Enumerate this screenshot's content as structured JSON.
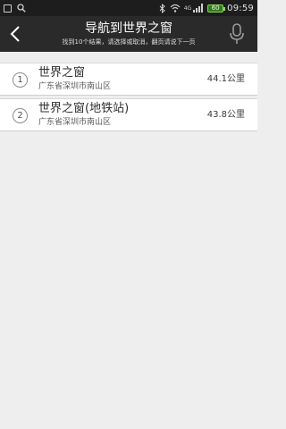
{
  "status_bar": {
    "icons_left": [
      "notification-box-icon",
      "search-icon"
    ],
    "icons_right": [
      "bluetooth-icon",
      "wifi-icon",
      "signal-4g-icon",
      "battery-icon"
    ],
    "network": "4G",
    "battery_level": "60",
    "time": "09:59"
  },
  "header": {
    "title": "导航到世界之窗",
    "subtitle": "找到10个结果，请选择或取消，翻页请说下一页",
    "back_icon": "back-chevron-icon",
    "mic_icon": "microphone-icon"
  },
  "results": [
    {
      "index": "1",
      "name": "世界之窗",
      "address": "广东省深圳市南山区",
      "distance": "44.1公里"
    },
    {
      "index": "2",
      "name": "世界之窗(地铁站)",
      "address": "广东省深圳市南山区",
      "distance": "43.8公里"
    }
  ],
  "colors": {
    "header_bg": "#2a2a2a",
    "status_bg": "#1d1d1d",
    "page_bg": "#eeeeee",
    "battery_green": "#8ad35f"
  }
}
